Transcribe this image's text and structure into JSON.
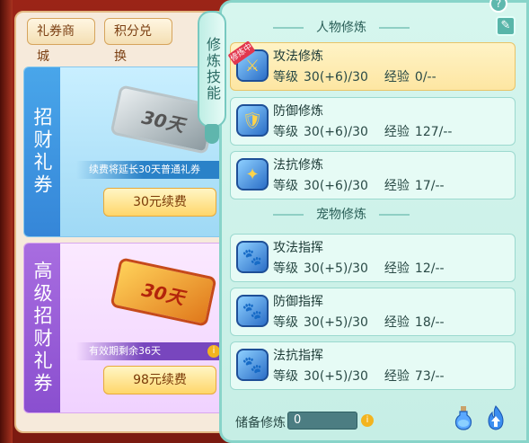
{
  "mall": {
    "tabs": [
      "礼券商城",
      "积分兑换"
    ],
    "cards": [
      {
        "side_title": "招财礼券",
        "ticket_text": "30天",
        "note": "续费将延长30天普通礼券",
        "button": "30元续费"
      },
      {
        "side_title": "高级招财礼券",
        "ticket_text": "30天",
        "note": "有效期剩余36天",
        "button": "98元续费"
      }
    ]
  },
  "side_tab": {
    "label": "修炼技能"
  },
  "sections": {
    "character": "人物修炼",
    "pet": "宠物修炼"
  },
  "labels": {
    "level": "等级",
    "exp": "经验",
    "active_badge": "修炼中"
  },
  "skills": [
    {
      "name": "攻法修炼",
      "level": "30(+6)/30",
      "exp": "0/--",
      "icon": "sword-book-icon",
      "selected": true
    },
    {
      "name": "防御修炼",
      "level": "30(+6)/30",
      "exp": "127/--",
      "icon": "shield-icon",
      "selected": false
    },
    {
      "name": "法抗修炼",
      "level": "30(+6)/30",
      "exp": "17/--",
      "icon": "magic-shield-icon",
      "selected": false
    },
    {
      "name": "攻法指挥",
      "level": "30(+5)/30",
      "exp": "12/--",
      "icon": "paw-attack-icon",
      "selected": false
    },
    {
      "name": "防御指挥",
      "level": "30(+5)/30",
      "exp": "18/--",
      "icon": "paw-shield-icon",
      "selected": false
    },
    {
      "name": "法抗指挥",
      "level": "30(+5)/30",
      "exp": "73/--",
      "icon": "paw-magic-icon",
      "selected": false
    }
  ],
  "footer": {
    "reserve_label": "储备修炼",
    "reserve_value": "0"
  },
  "colors": {
    "panel_bg": "#d6f6ee",
    "selected_row": "#fde6a2",
    "accent": "#5fb8ae"
  }
}
